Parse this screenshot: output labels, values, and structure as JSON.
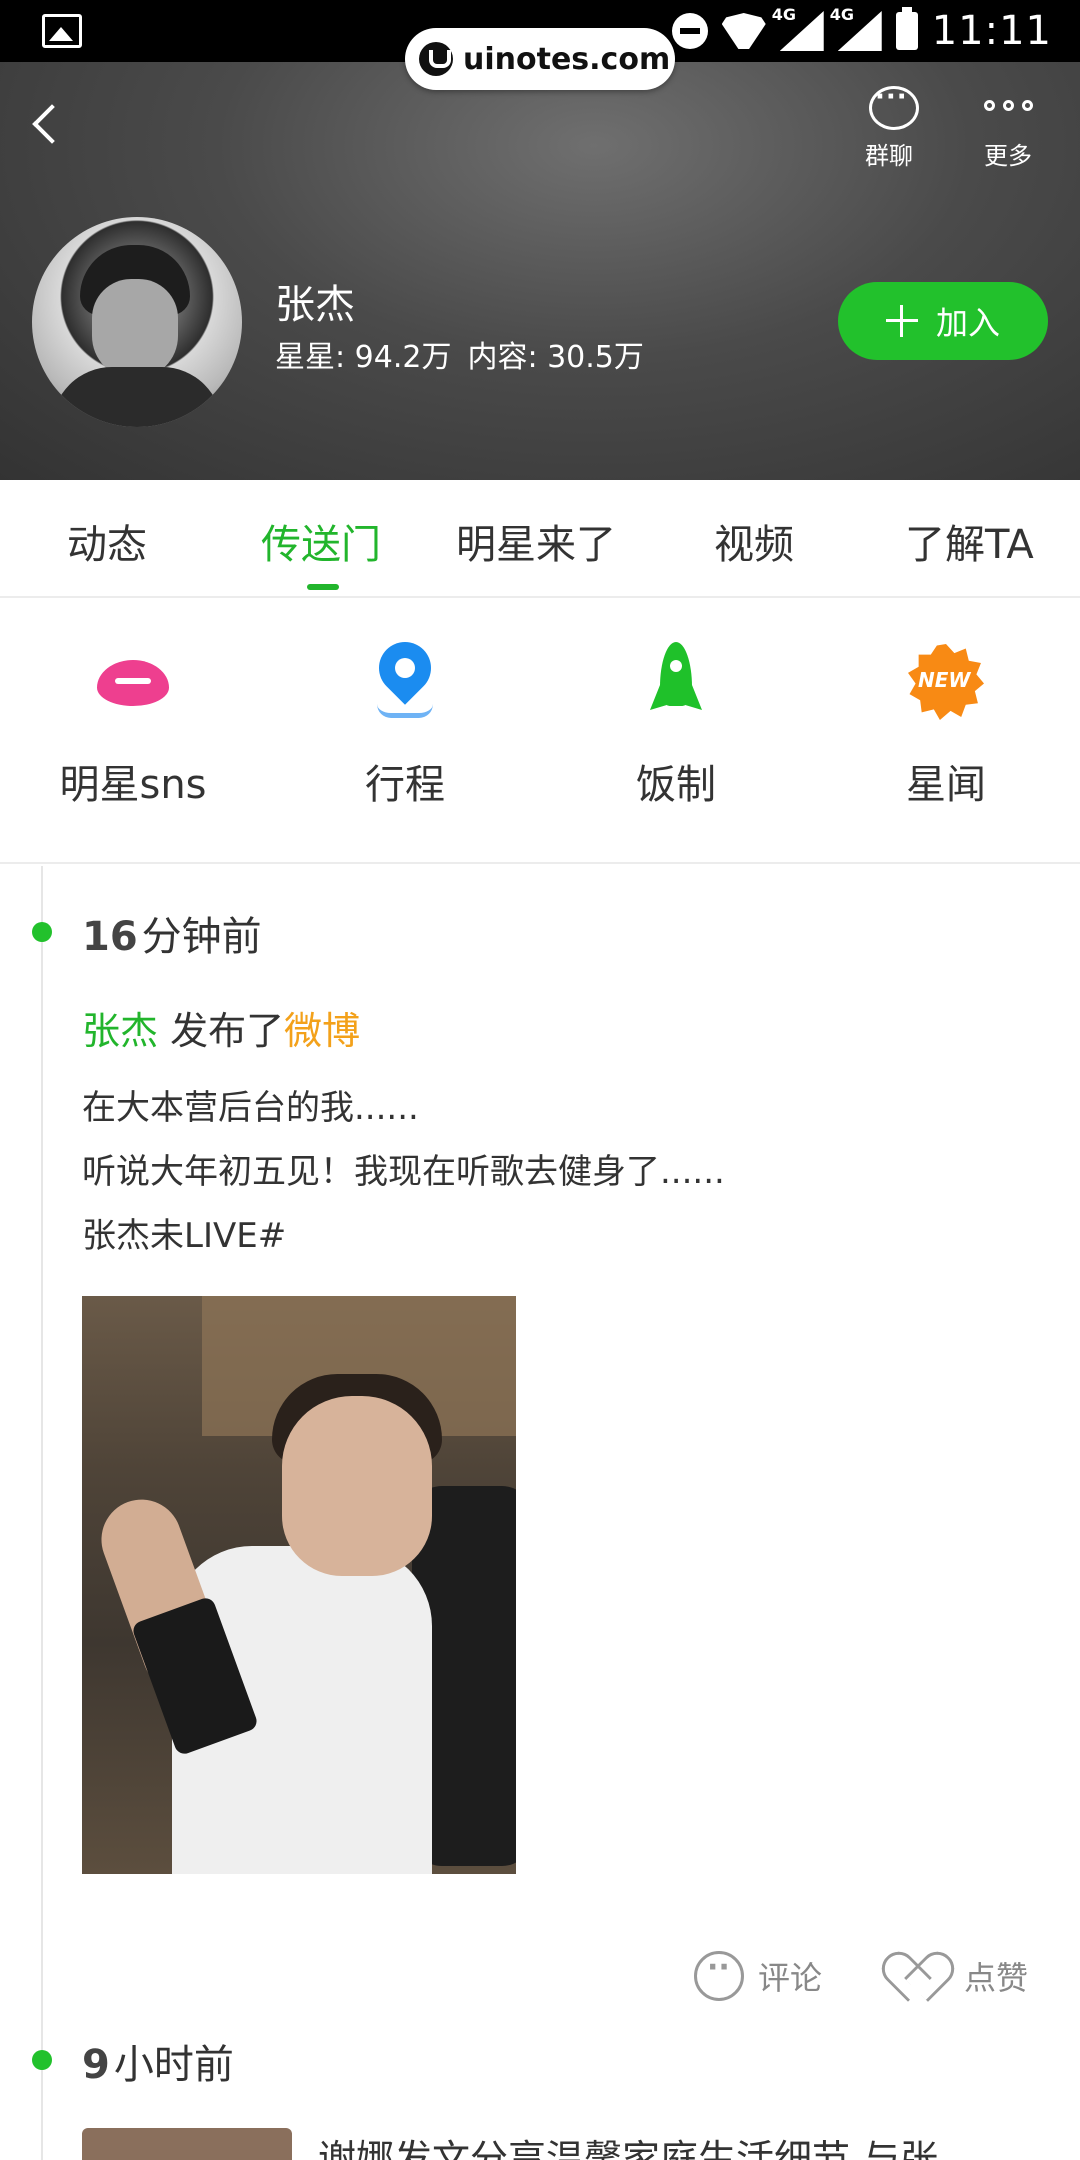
{
  "status_bar": {
    "network_1": "4G",
    "network_2": "4G",
    "time": "11:11"
  },
  "watermark": {
    "text": "uinotes.com"
  },
  "header": {
    "actions": [
      {
        "label": "群聊",
        "icon": "group-chat-icon"
      },
      {
        "label": "更多",
        "icon": "more-icon"
      }
    ],
    "star_name": "张杰",
    "stars_stat": "星星: 94.2万",
    "content_stat": "内容: 30.5万",
    "join_label": "加入"
  },
  "tabs": [
    {
      "label": "动态",
      "active": false
    },
    {
      "label": "传送门",
      "active": true
    },
    {
      "label": "明星来了",
      "active": false
    },
    {
      "label": "视频",
      "active": false
    },
    {
      "label": "了解TA",
      "active": false
    }
  ],
  "shortcuts": [
    {
      "label": "明星sns",
      "icon": "lips-icon",
      "color": "#ee3f8f"
    },
    {
      "label": "行程",
      "icon": "location-pin-icon",
      "color": "#1b8cf0"
    },
    {
      "label": "饭制",
      "icon": "rocket-icon",
      "color": "#1fc12a"
    },
    {
      "label": "星闻",
      "icon": "new-badge-icon",
      "color": "#f88a14",
      "badge_text": "NEW"
    }
  ],
  "feed": [
    {
      "time_num": "16",
      "time_unit": "分钟前",
      "author": "张杰",
      "action": " 发布了",
      "source": "微博",
      "lines": [
        "在大本营后台的我......",
        "听说大年初五见！我现在听歌去健身了......",
        "张杰未LIVE#"
      ],
      "comment_label": "评论",
      "like_label": "点赞"
    },
    {
      "time_num": "9",
      "time_unit": "小时前",
      "title": "谢娜发文分享温馨家庭生活细节 与张"
    }
  ],
  "colors": {
    "accent": "#22b52c",
    "join_button": "#22c12c",
    "source_highlight": "#f3a11a"
  }
}
